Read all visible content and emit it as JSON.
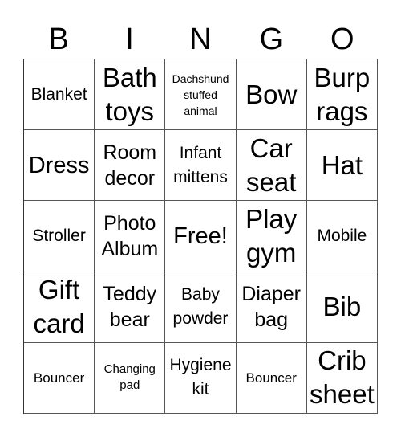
{
  "header": {
    "letters": [
      "B",
      "I",
      "N",
      "G",
      "O"
    ]
  },
  "cells": [
    {
      "text": "Blanket",
      "size": "s-sm"
    },
    {
      "text": "Bath toys",
      "size": "s-xl"
    },
    {
      "text": "Dachshund stuffed animal",
      "size": "s-tiny"
    },
    {
      "text": "Bow",
      "size": "s-xl"
    },
    {
      "text": "Burp rags",
      "size": "s-xl"
    },
    {
      "text": "Dress",
      "size": "s-lg"
    },
    {
      "text": "Room decor",
      "size": "s-md"
    },
    {
      "text": "Infant mittens",
      "size": "s-sm"
    },
    {
      "text": "Car seat",
      "size": "s-xl"
    },
    {
      "text": "Hat",
      "size": "s-xl"
    },
    {
      "text": "Stroller",
      "size": "s-sm"
    },
    {
      "text": "Photo Album",
      "size": "s-md"
    },
    {
      "text": "Free!",
      "size": "s-lg"
    },
    {
      "text": "Play gym",
      "size": "s-xl"
    },
    {
      "text": "Mobile",
      "size": "s-sm"
    },
    {
      "text": "Gift card",
      "size": "s-xl"
    },
    {
      "text": "Teddy bear",
      "size": "s-md"
    },
    {
      "text": "Baby powder",
      "size": "s-sm"
    },
    {
      "text": "Diaper bag",
      "size": "s-md"
    },
    {
      "text": "Bib",
      "size": "s-xl"
    },
    {
      "text": "Bouncer",
      "size": "s-xs"
    },
    {
      "text": "Changing pad",
      "size": "s-xxs"
    },
    {
      "text": "Hygiene kit",
      "size": "s-sm"
    },
    {
      "text": "Bouncer",
      "size": "s-xs"
    },
    {
      "text": "Crib sheet",
      "size": "s-xl"
    }
  ]
}
